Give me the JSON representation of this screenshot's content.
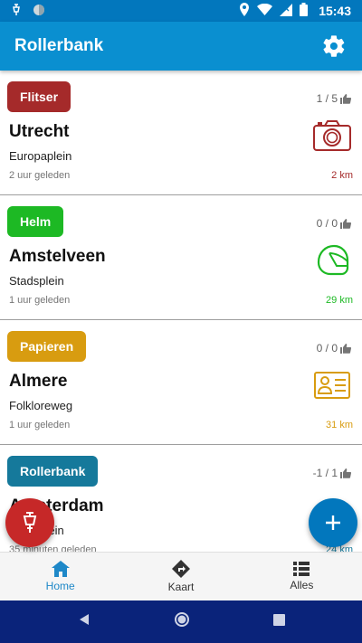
{
  "status_bar": {
    "time": "15:43"
  },
  "app": {
    "title": "Rollerbank"
  },
  "colors": {
    "primary": "#0a8fd0",
    "status": "#0277bd",
    "red": "#a52a2a",
    "green": "#1db924",
    "amber": "#d89c10",
    "teal": "#15799b",
    "nav_active": "#1e88c8"
  },
  "reports": [
    {
      "badge": "Flitser",
      "votes": "1 / 5",
      "city": "Utrecht",
      "street": "Europaplein",
      "time": "2 uur geleden",
      "distance": "2 km",
      "icon": "camera-icon"
    },
    {
      "badge": "Helm",
      "votes": "0 / 0",
      "city": "Amstelveen",
      "street": "Stadsplein",
      "time": "1 uur geleden",
      "distance": "29 km",
      "icon": "helmet-icon"
    },
    {
      "badge": "Papieren",
      "votes": "0 / 0",
      "city": "Almere",
      "street": "Folkloreweg",
      "time": "1 uur geleden",
      "distance": "31 km",
      "icon": "id-card-icon"
    },
    {
      "badge": "Rollerbank",
      "votes": "-1 / 1",
      "city": "Amsterdam",
      "street": "Stadsplein",
      "time": "35 minuten geleden",
      "distance": "24 km",
      "icon": "dyno-icon"
    }
  ],
  "bottom_nav": [
    {
      "label": "Home",
      "icon": "home-icon",
      "active": true
    },
    {
      "label": "Kaart",
      "icon": "directions-icon",
      "active": false
    },
    {
      "label": "Alles",
      "icon": "list-icon",
      "active": false
    }
  ]
}
